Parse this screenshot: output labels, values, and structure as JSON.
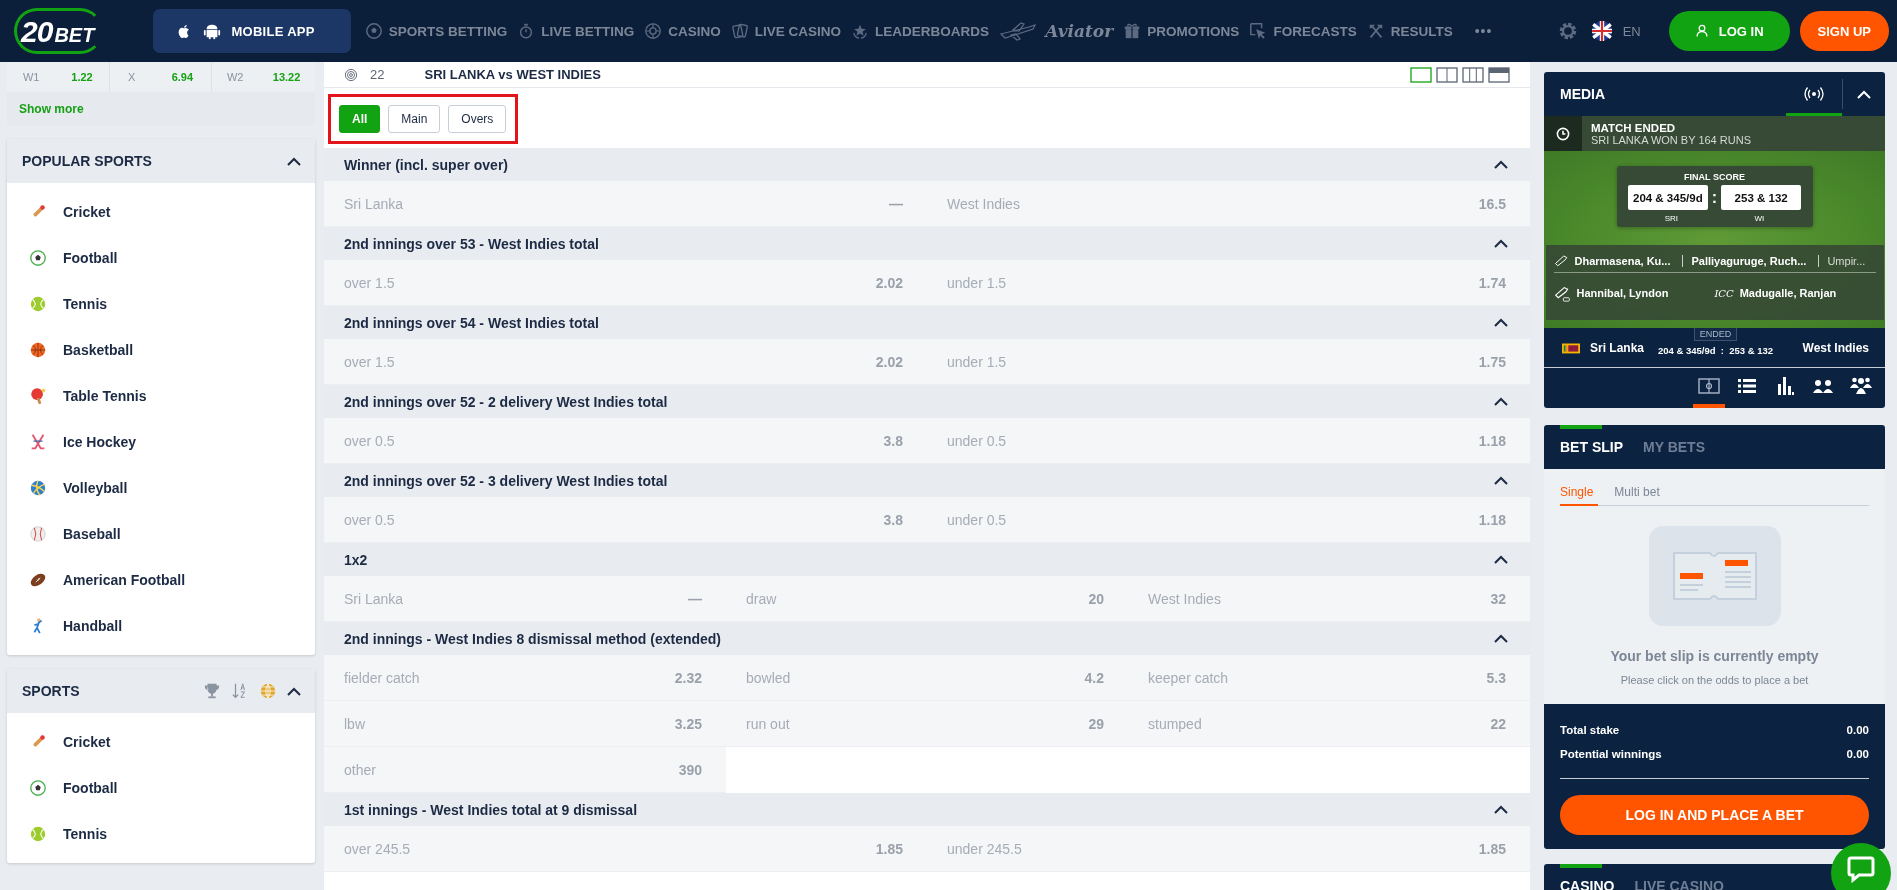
{
  "header": {
    "logo": {
      "number": "20",
      "word": "BET"
    },
    "mobile_app": "MOBILE APP",
    "nav": [
      {
        "label": "SPORTS BETTING",
        "kind": "link"
      },
      {
        "label": "LIVE BETTING",
        "kind": "link"
      },
      {
        "label": "CASINO",
        "kind": "link"
      },
      {
        "label": "LIVE CASINO",
        "kind": "link"
      },
      {
        "label": "LEADERBOARDS",
        "kind": "link"
      },
      {
        "label": "Aviator",
        "kind": "logo"
      },
      {
        "label": "PROMOTIONS",
        "kind": "link"
      },
      {
        "label": "FORECASTS",
        "kind": "link"
      },
      {
        "label": "RESULTS",
        "kind": "link"
      }
    ],
    "more": "•••",
    "language": "EN",
    "login": "LOG IN",
    "signup": "SIGN UP"
  },
  "sidebar": {
    "match_odds": [
      {
        "label": "W1",
        "odds": "1.22"
      },
      {
        "label": "X",
        "odds": "6.94"
      },
      {
        "label": "W2",
        "odds": "13.22"
      }
    ],
    "show_more": "Show more",
    "popular": {
      "title": "POPULAR SPORTS",
      "expanded": true,
      "items": [
        "Cricket",
        "Football",
        "Tennis",
        "Basketball",
        "Table Tennis",
        "Ice Hockey",
        "Volleyball",
        "Baseball",
        "American Football",
        "Handball"
      ]
    },
    "sports": {
      "title": "SPORTS",
      "expanded": true,
      "items": [
        "Cricket",
        "Football",
        "Tennis"
      ]
    }
  },
  "match": {
    "count": "22",
    "title": "SRI LANKA vs WEST INDIES",
    "view_toggles": [
      {
        "selected": true
      },
      {
        "selected": false
      },
      {
        "selected": false
      },
      {
        "selected": false
      }
    ],
    "filters": [
      {
        "label": "All",
        "selected": true
      },
      {
        "label": "Main",
        "selected": false
      },
      {
        "label": "Overs",
        "selected": false
      }
    ],
    "markets": [
      {
        "title": "Winner (incl. super over)",
        "expanded": true,
        "rows": [
          [
            {
              "label": "Sri Lanka",
              "odds": "—"
            },
            {
              "label": "West Indies",
              "odds": "16.5"
            }
          ]
        ]
      },
      {
        "title": "2nd innings over 53 - West Indies total",
        "expanded": true,
        "rows": [
          [
            {
              "label": "over 1.5",
              "odds": "2.02"
            },
            {
              "label": "under 1.5",
              "odds": "1.74"
            }
          ]
        ]
      },
      {
        "title": "2nd innings over 54 - West Indies total",
        "expanded": true,
        "rows": [
          [
            {
              "label": "over 1.5",
              "odds": "2.02"
            },
            {
              "label": "under 1.5",
              "odds": "1.75"
            }
          ]
        ]
      },
      {
        "title": "2nd innings over 52 - 2 delivery West Indies total",
        "expanded": true,
        "rows": [
          [
            {
              "label": "over 0.5",
              "odds": "3.8"
            },
            {
              "label": "under 0.5",
              "odds": "1.18"
            }
          ]
        ]
      },
      {
        "title": "2nd innings over 52 - 3 delivery West Indies total",
        "expanded": true,
        "rows": [
          [
            {
              "label": "over 0.5",
              "odds": "3.8"
            },
            {
              "label": "under 0.5",
              "odds": "1.18"
            }
          ]
        ]
      },
      {
        "title": "1x2",
        "expanded": true,
        "rows": [
          [
            {
              "label": "Sri Lanka",
              "odds": "—"
            },
            {
              "label": "draw",
              "odds": "20"
            },
            {
              "label": "West Indies",
              "odds": "32"
            }
          ]
        ]
      },
      {
        "title": "2nd innings - West Indies 8 dismissal method (extended)",
        "expanded": true,
        "rows": [
          [
            {
              "label": "fielder catch",
              "odds": "2.32"
            },
            {
              "label": "bowled",
              "odds": "4.2"
            },
            {
              "label": "keeper catch",
              "odds": "5.3"
            }
          ],
          [
            {
              "label": "lbw",
              "odds": "3.25"
            },
            {
              "label": "run out",
              "odds": "29"
            },
            {
              "label": "stumped",
              "odds": "22"
            }
          ],
          [
            {
              "label": "other",
              "odds": "390"
            }
          ]
        ]
      },
      {
        "title": "1st innings - West Indies total at 9 dismissal",
        "expanded": true,
        "rows": [
          [
            {
              "label": "over 245.5",
              "odds": "1.85"
            },
            {
              "label": "under 245.5",
              "odds": "1.85"
            }
          ]
        ]
      }
    ]
  },
  "media": {
    "title": "MEDIA",
    "status": "MATCH ENDED",
    "result": "SRI LANKA WON BY 164 RUNS",
    "final_score": {
      "title": "FINAL SCORE",
      "home": "204 & 345/9d",
      "separator": ":",
      "away": "253 & 132",
      "home_code": "SRI",
      "away_code": "WI"
    },
    "officials": {
      "umpires": [
        "Dharmasena, Ku...",
        "Palliyaguruge, Ruch...",
        "Umpir..."
      ],
      "tv_umpire": "Hannibal, Lyndon",
      "referee_org": "ICC",
      "referee": "Madugalle, Ranjan"
    },
    "scoreboard": {
      "home": "Sri Lanka",
      "status": "ENDED",
      "score": "204 & 345/9d  :  253 & 132",
      "away": "West Indies"
    },
    "tabs": [
      {
        "selected": true
      },
      {
        "selected": false
      },
      {
        "selected": false
      },
      {
        "selected": false
      },
      {
        "selected": false
      }
    ]
  },
  "bet_slip": {
    "tabs": [
      {
        "label": "BET SLIP",
        "selected": true
      },
      {
        "label": "MY BETS",
        "selected": false
      }
    ],
    "modes": [
      {
        "label": "Single",
        "selected": true
      },
      {
        "label": "Multi bet",
        "selected": false
      }
    ],
    "empty_title": "Your bet slip is currently empty",
    "empty_hint": "Please click on the odds to place a bet",
    "totals": [
      {
        "label": "Total stake",
        "value": "0.00"
      },
      {
        "label": "Potential winnings",
        "value": "0.00"
      }
    ],
    "action": "LOG IN AND PLACE A BET"
  },
  "casino": {
    "tabs": [
      {
        "label": "CASINO",
        "selected": true
      },
      {
        "label": "LIVE CASINO",
        "selected": false
      }
    ]
  }
}
